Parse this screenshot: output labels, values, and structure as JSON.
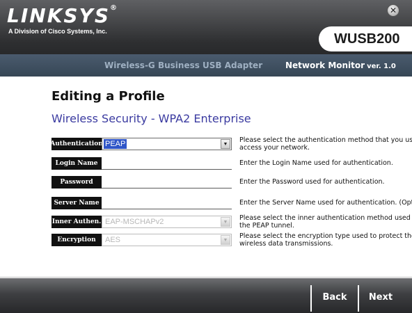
{
  "header": {
    "logo_text": "LINKSYS",
    "logo_reg": "®",
    "logo_sub": "A Division of Cisco Systems, Inc.",
    "close_glyph": "✕",
    "model": "WUSB200",
    "product_name": "Wireless-G Business USB Adapter",
    "monitor_name": "Network Monitor",
    "version": "ver. 1.0"
  },
  "main": {
    "title": "Editing a Profile",
    "section_title": "Wireless Security - WPA2 Enterprise"
  },
  "form": {
    "authentication": {
      "label": "Authentication",
      "value": "PEAP",
      "description": "Please select the authentication method that you use to access your network."
    },
    "login_name": {
      "label": "Login Name",
      "value": "",
      "description": "Enter the Login Name used for authentication."
    },
    "password": {
      "label": "Password",
      "value": "",
      "description": "Enter the Password used for authentication."
    },
    "server_name": {
      "label": "Server Name",
      "value": "",
      "description": "Enter the Server Name used for authentication. (Optional)"
    },
    "inner_authen": {
      "label": "Inner Authen.",
      "value": "EAP-MSCHAPv2",
      "description": "Please select the inner authentication method used inside the PEAP tunnel."
    },
    "encryption": {
      "label": "Encryption",
      "value": "AES",
      "description": "Please select the encryption type used to protect the wireless data transmissions."
    },
    "dropdown_arrow": "▼"
  },
  "footer": {
    "back_label": "Back",
    "next_label": "Next"
  },
  "colors": {
    "header_dark": "#2e2f31",
    "sub_band": "#4a5b6e",
    "section_title": "#3a3aa0",
    "select_highlight": "#2f55c8"
  }
}
